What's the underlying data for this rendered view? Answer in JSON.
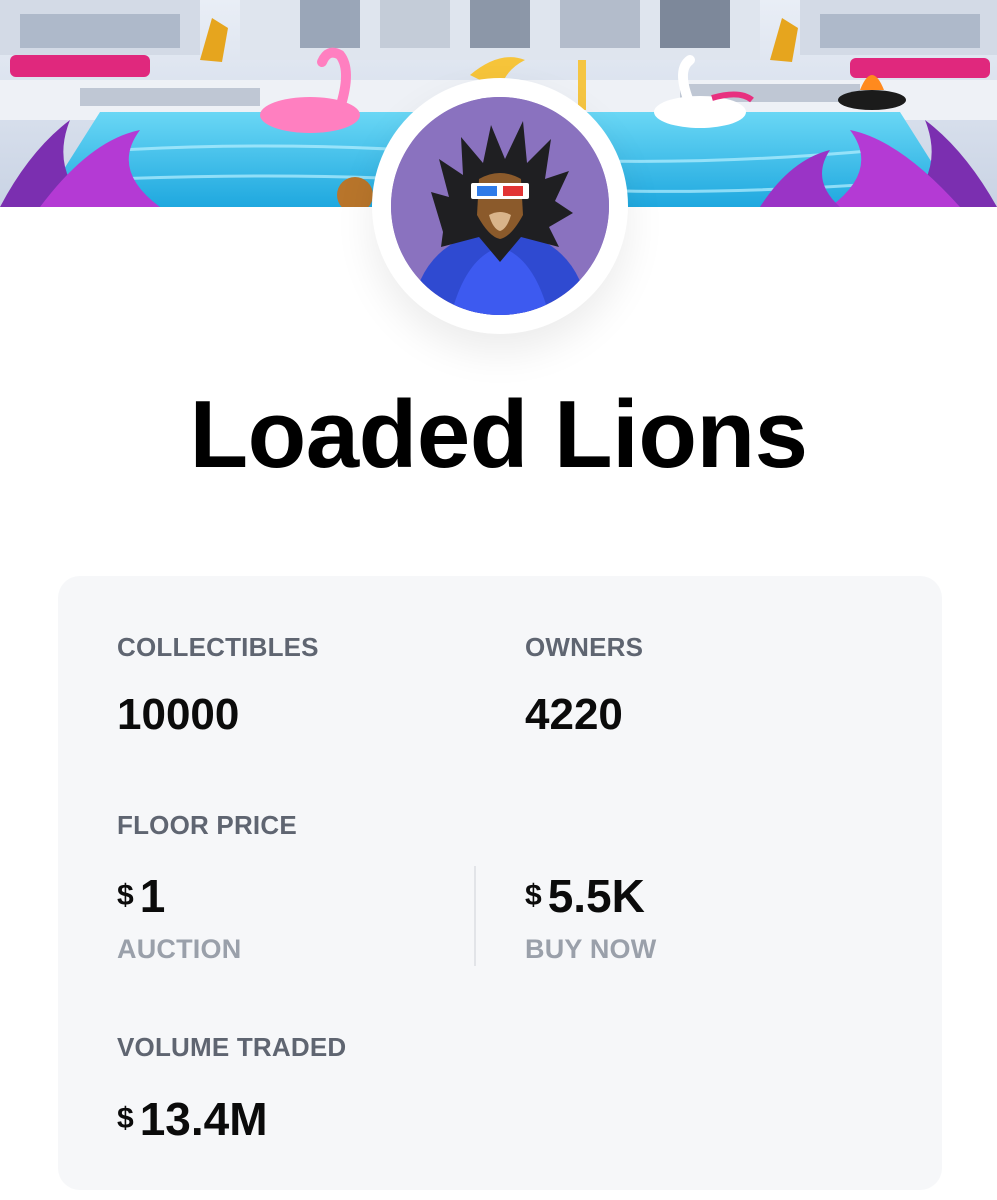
{
  "collection": {
    "name": "Loaded Lions"
  },
  "stats": {
    "collectibles": {
      "label": "COLLECTIBLES",
      "value": "10000"
    },
    "owners": {
      "label": "OWNERS",
      "value": "4220"
    },
    "floor_price": {
      "label": "FLOOR PRICE",
      "auction": {
        "currency": "$",
        "amount": "1",
        "label": "AUCTION"
      },
      "buy_now": {
        "currency": "$",
        "amount": "5.5K",
        "label": "BUY NOW"
      }
    },
    "volume_traded": {
      "label": "VOLUME TRADED",
      "currency": "$",
      "amount": "13.4M"
    }
  },
  "colors": {
    "card_background": "#f6f7f9",
    "label_gray": "#5f6571",
    "sub_label_gray": "#9aa0aa",
    "avatar_background": "#8a72bf",
    "pool_blue": "#3fc6ef"
  },
  "icons": {
    "banner": "pool-party-banner-image",
    "avatar": "lion-avatar-image"
  }
}
